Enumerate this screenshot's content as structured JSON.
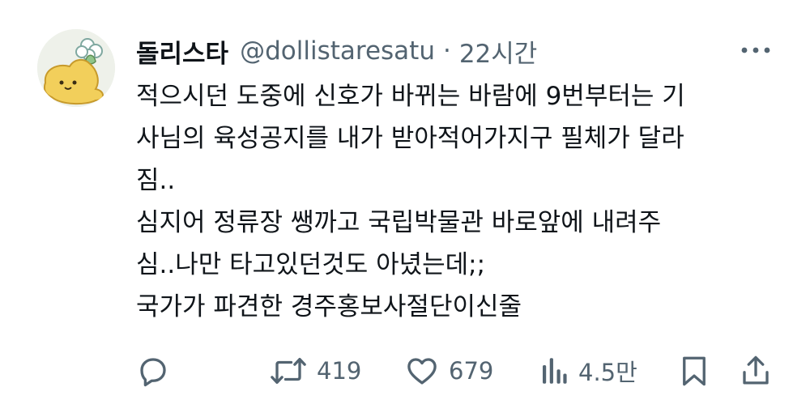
{
  "author": {
    "display_name": "돌리스타",
    "handle": "@dollistaresatu",
    "separator": "·",
    "time": "22시간"
  },
  "tweet": {
    "lines": [
      "적으시던 도중에 신호가 바뀌는 바람에 9번부터는 기",
      "사님의 육성공지를 내가 받아적어가지구 필체가 달라",
      "짐..",
      "심지어 정류장 쌩까고 국립박물관 바로앞에 내려주",
      "심..나만 타고있던것도 아녔는데;;",
      "국가가 파견한 경주홍보사절단이신줄"
    ]
  },
  "actions": {
    "reply": {
      "icon": "reply-icon"
    },
    "retweet": {
      "icon": "retweet-icon",
      "count": "419"
    },
    "like": {
      "icon": "heart-icon",
      "count": "679"
    },
    "views": {
      "icon": "views-icon",
      "count": "4.5만"
    },
    "bookmark": {
      "icon": "bookmark-icon"
    },
    "share": {
      "icon": "share-icon"
    }
  },
  "menu": {
    "icon": "more-icon"
  },
  "colors": {
    "text": "#0f1419",
    "secondary": "#536471",
    "avatar_yellow": "#f2cf5b",
    "avatar_bg": "#eef1ea"
  }
}
